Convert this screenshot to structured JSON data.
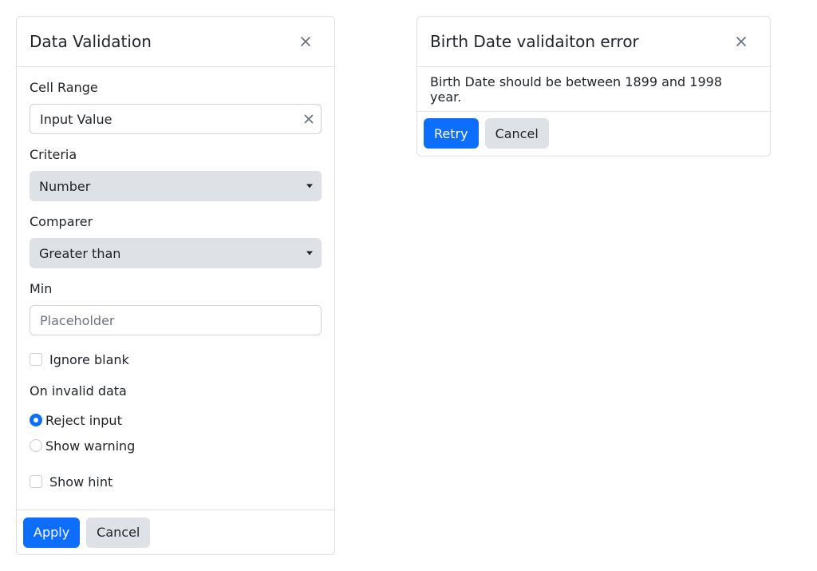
{
  "validation_dialog": {
    "title": "Data Validation",
    "close_icon": "close-icon",
    "cell_range": {
      "label": "Cell Range",
      "value": "Input Value",
      "clear_icon": "clear-icon"
    },
    "criteria": {
      "label": "Criteria",
      "selected": "Number"
    },
    "comparer": {
      "label": "Comparer",
      "selected": "Greater than"
    },
    "min": {
      "label": "Min",
      "placeholder": "Placeholder"
    },
    "ignore_blank": {
      "label": "Ignore blank",
      "checked": false
    },
    "on_invalid": {
      "label": "On invalid data",
      "options": [
        {
          "label": "Reject input",
          "checked": true
        },
        {
          "label": "Show warning",
          "checked": false
        }
      ]
    },
    "show_hint": {
      "label": "Show hint",
      "checked": false
    },
    "apply_label": "Apply",
    "cancel_label": "Cancel"
  },
  "error_dialog": {
    "title": "Birth Date validaiton error",
    "close_icon": "close-icon",
    "message": "Birth Date should be between 1899 and 1998 year.",
    "retry_label": "Retry",
    "cancel_label": "Cancel"
  },
  "colors": {
    "primary": "#0d6efd",
    "secondary_bg": "#dee1e5",
    "border": "#dee2e6"
  }
}
